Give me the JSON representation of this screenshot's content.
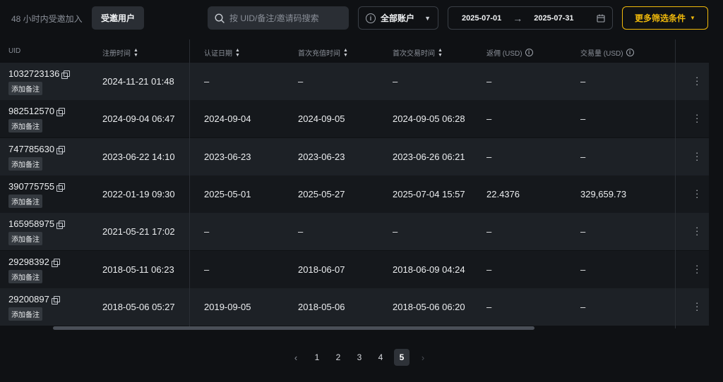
{
  "toolbar": {
    "recent_label": "48 小时内受邀加入",
    "invited_tab": "受邀用户",
    "search_placeholder": "按 UID/备注/邀请码搜索",
    "account_label": "全部账户",
    "date_start": "2025-07-01",
    "date_end": "2025-07-31",
    "more_filters": "更多筛选条件"
  },
  "table": {
    "headers": {
      "uid": "UID",
      "reg_time": "注册时间",
      "kyc_date": "认证日期",
      "first_deposit": "首次充值时间",
      "first_trade": "首次交易时间",
      "rebate": "返佣 (USD)",
      "volume": "交易量 (USD)"
    },
    "note_label": "添加备注",
    "rows": [
      {
        "uid": "1032723136",
        "reg_time": "2024-11-21 01:48",
        "kyc_date": "–",
        "first_deposit": "–",
        "first_trade": "–",
        "rebate": "–",
        "volume": "–"
      },
      {
        "uid": "982512570",
        "reg_time": "2024-09-04 06:47",
        "kyc_date": "2024-09-04",
        "first_deposit": "2024-09-05",
        "first_trade": "2024-09-05 06:28",
        "rebate": "–",
        "volume": "–"
      },
      {
        "uid": "747785630",
        "reg_time": "2023-06-22 14:10",
        "kyc_date": "2023-06-23",
        "first_deposit": "2023-06-23",
        "first_trade": "2023-06-26 06:21",
        "rebate": "–",
        "volume": "–"
      },
      {
        "uid": "390775755",
        "reg_time": "2022-01-19 09:30",
        "kyc_date": "2025-05-01",
        "first_deposit": "2025-05-27",
        "first_trade": "2025-07-04 15:57",
        "rebate": "22.4376",
        "volume": "329,659.73"
      },
      {
        "uid": "165958975",
        "reg_time": "2021-05-21 17:02",
        "kyc_date": "–",
        "first_deposit": "–",
        "first_trade": "–",
        "rebate": "–",
        "volume": "–"
      },
      {
        "uid": "29298392",
        "reg_time": "2018-05-11 06:23",
        "kyc_date": "–",
        "first_deposit": "2018-06-07",
        "first_trade": "2018-06-09 04:24",
        "rebate": "–",
        "volume": "–"
      },
      {
        "uid": "29200897",
        "reg_time": "2018-05-06 05:27",
        "kyc_date": "2019-09-05",
        "first_deposit": "2018-05-06",
        "first_trade": "2018-05-06 06:20",
        "rebate": "–",
        "volume": "–"
      }
    ]
  },
  "pagination": {
    "pages": [
      "1",
      "2",
      "3",
      "4",
      "5"
    ],
    "current": "5",
    "prev_icon": "chevron-left-icon",
    "next_icon": "chevron-right-icon"
  },
  "colors": {
    "accent": "#f0b90b",
    "background": "#0f1114",
    "row_odd": "#1d2126",
    "row_even": "#15181c"
  }
}
